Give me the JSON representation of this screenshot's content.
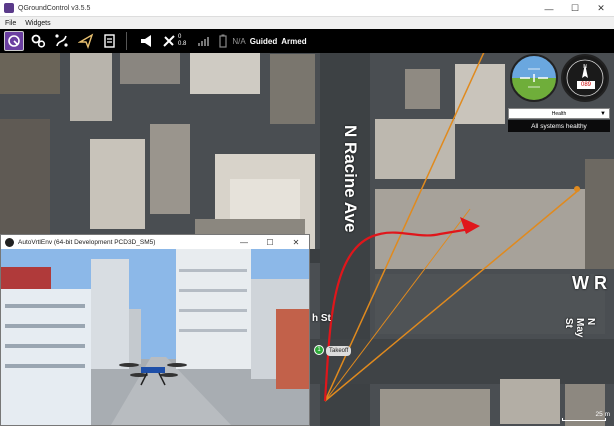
{
  "window": {
    "title": "QGroundControl v3.5.5",
    "controls": [
      "—",
      "☐",
      "✕"
    ]
  },
  "menu": {
    "items": [
      "File",
      "Widgets"
    ]
  },
  "toolbar": {
    "gps_count": "0",
    "gps_hdop": "0.8",
    "battery": "N/A",
    "flight_mode": "Guided",
    "arm_state": "Armed"
  },
  "instruments": {
    "compass_heading": "089"
  },
  "health": {
    "select_value": "Health",
    "status": "All systems healthy"
  },
  "map": {
    "street_north": "N Racine Ave",
    "street_west": "W R",
    "street_south": "N May St",
    "street_small": "h St",
    "waypoint_number": "1",
    "waypoint_label": "Takeoff",
    "scale": "25 m"
  },
  "sim_window": {
    "title": "AutoVrtlEnv (64-bit Development PCD3D_SM5)",
    "controls": [
      "—",
      "☐",
      "✕"
    ]
  },
  "colors": {
    "accent": "#6b3fa0",
    "path_red": "#e0161b",
    "line_orange": "#e08a1e",
    "waypoint_green": "#2faa3a"
  }
}
